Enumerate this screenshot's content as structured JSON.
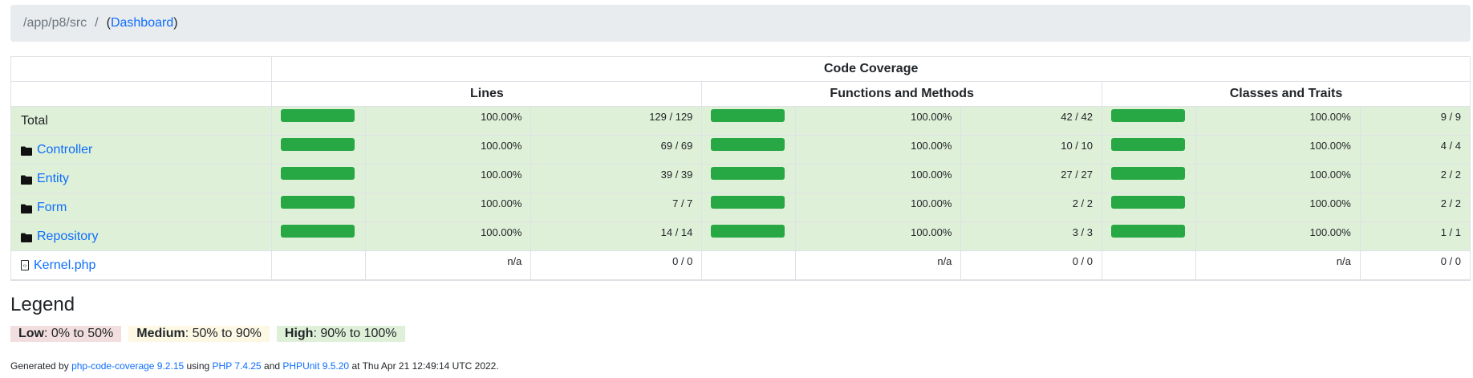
{
  "breadcrumb": {
    "path": "/app/p8/src",
    "separator": "/",
    "dashboard_link": "Dashboard",
    "open_paren": "(",
    "close_paren": ")"
  },
  "table": {
    "header_code_coverage": "Code Coverage",
    "header_lines": "Lines",
    "header_functions": "Functions and Methods",
    "header_classes": "Classes and Traits",
    "rows": [
      {
        "name": "Total",
        "type": "total",
        "lines_pct": "100.00%",
        "lines_ratio": "129 / 129",
        "funcs_pct": "100.00%",
        "funcs_ratio": "42 / 42",
        "classes_pct": "100.00%",
        "classes_ratio": "9 / 9",
        "coverage": 1.0
      },
      {
        "name": "Controller",
        "type": "directory",
        "lines_pct": "100.00%",
        "lines_ratio": "69 / 69",
        "funcs_pct": "100.00%",
        "funcs_ratio": "10 / 10",
        "classes_pct": "100.00%",
        "classes_ratio": "4 / 4",
        "coverage": 1.0
      },
      {
        "name": "Entity",
        "type": "directory",
        "lines_pct": "100.00%",
        "lines_ratio": "39 / 39",
        "funcs_pct": "100.00%",
        "funcs_ratio": "27 / 27",
        "classes_pct": "100.00%",
        "classes_ratio": "2 / 2",
        "coverage": 1.0
      },
      {
        "name": "Form",
        "type": "directory",
        "lines_pct": "100.00%",
        "lines_ratio": "7 / 7",
        "funcs_pct": "100.00%",
        "funcs_ratio": "2 / 2",
        "classes_pct": "100.00%",
        "classes_ratio": "2 / 2",
        "coverage": 1.0
      },
      {
        "name": "Repository",
        "type": "directory",
        "lines_pct": "100.00%",
        "lines_ratio": "14 / 14",
        "funcs_pct": "100.00%",
        "funcs_ratio": "3 / 3",
        "classes_pct": "100.00%",
        "classes_ratio": "1 / 1",
        "coverage": 1.0
      },
      {
        "name": "Kernel.php",
        "type": "file",
        "lines_pct": "n/a",
        "lines_ratio": "0 / 0",
        "funcs_pct": "n/a",
        "funcs_ratio": "0 / 0",
        "classes_pct": "n/a",
        "classes_ratio": "0 / 0",
        "coverage": null
      }
    ]
  },
  "legend": {
    "title": "Legend",
    "low_label": "Low",
    "low_range": ": 0% to 50%",
    "medium_label": "Medium",
    "medium_range": ": 50% to 90%",
    "high_label": "High",
    "high_range": ": 90% to 100%"
  },
  "footer": {
    "generated_by": "Generated by ",
    "tool_link": "php-code-coverage 9.2.15",
    "using": " using ",
    "php_link": "PHP 7.4.25",
    "and": " and ",
    "phpunit_link": "PHPUnit 9.5.20",
    "at": " at Thu Apr 21 12:49:14 UTC 2022."
  },
  "colors": {
    "bar_success": "#28a745",
    "row_success": "#dff0d8",
    "link": "#0d6efd",
    "legend_low": "#f2dede",
    "legend_medium": "#fcf8e3",
    "legend_high": "#dff0d8"
  },
  "icons": {
    "directory": "folder-icon",
    "file": "code-file-icon"
  }
}
